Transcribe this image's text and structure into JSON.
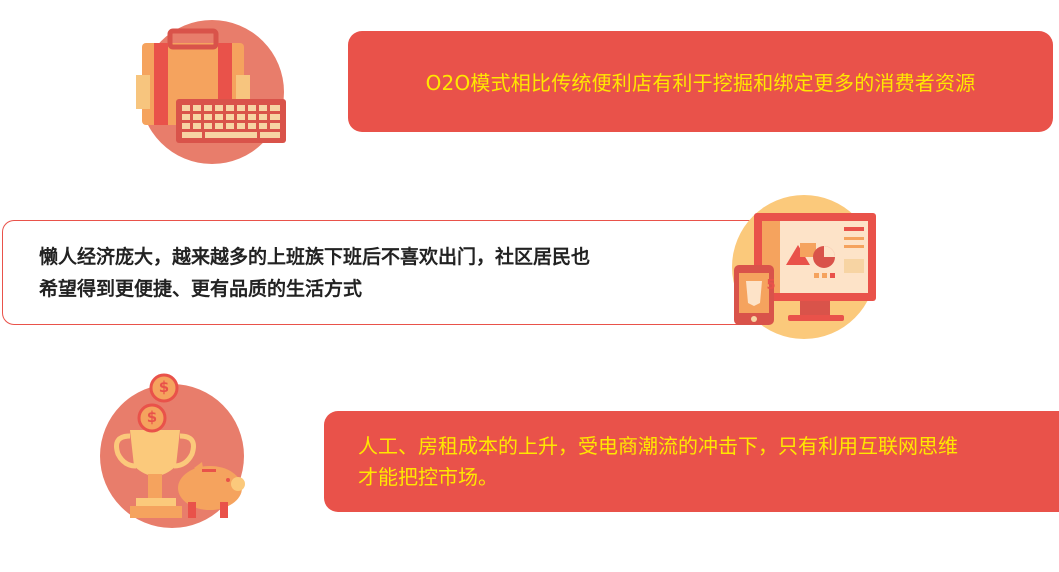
{
  "items": [
    {
      "lines": [
        "O2O模式相比传统便利店有利于挖掘和绑定更多的消费者资源"
      ],
      "icon": "briefcase-keyboard-icon"
    },
    {
      "lines": [
        "懒人经济庞大，越来越多的上班族下班后不喜欢出门，社区居民也",
        "希望得到更便捷、更有品质的生活方式"
      ],
      "icon": "monitor-phone-icon",
      "phone_badge": "5"
    },
    {
      "lines": [
        "人工、房租成本的上升，受电商潮流的冲击下，只有利用互联网思维",
        "才能把控市场。"
      ],
      "icon": "trophy-coins-piggybank-icon",
      "coin_symbol": "$"
    }
  ],
  "colors": {
    "accent_red": "#e9524a",
    "text_yellow": "#ffe700",
    "icon_circle_red": "#e87d6b",
    "icon_circle_orange": "#fbc97b"
  }
}
